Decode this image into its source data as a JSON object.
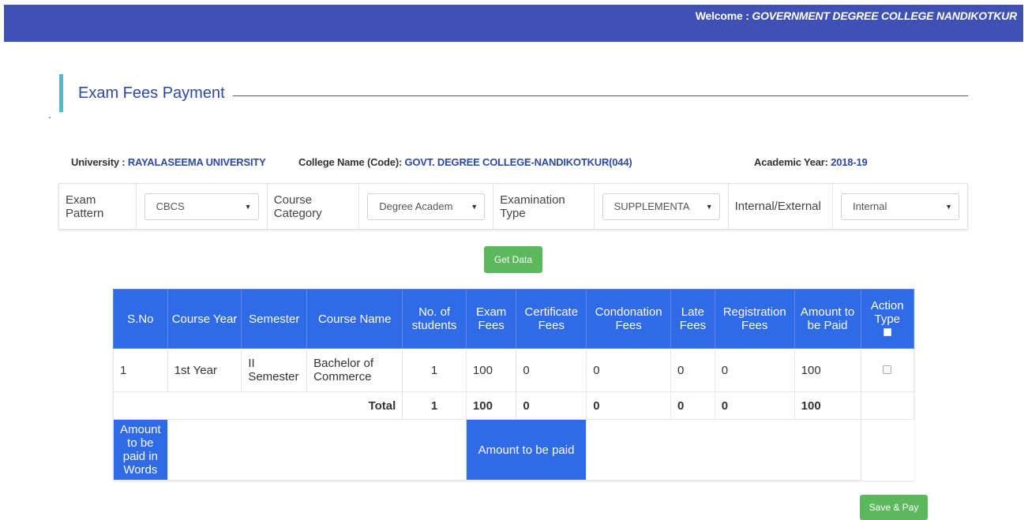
{
  "header": {
    "welcome_prefix": "Welcome : ",
    "welcome_college": "GOVERNMENT DEGREE COLLEGE NANDIKOTKUR"
  },
  "page": {
    "title": "Exam Fees Payment"
  },
  "info": {
    "university_label": "University : ",
    "university_value": "RAYALASEEMA UNIVERSITY",
    "college_label": "College Name (Code): ",
    "college_value": "GOVT. DEGREE COLLEGE-NANDIKOTKUR(044)",
    "year_label": "Academic Year: ",
    "year_value": "2018-19"
  },
  "filters": {
    "exam_pattern_label": "Exam Pattern",
    "exam_pattern_value": "CBCS",
    "course_category_label": "Course Category",
    "course_category_value": "Degree Academ",
    "exam_type_label": "Examination Type",
    "exam_type_value": "SUPPLEMENTA",
    "int_ext_label": "Internal/External",
    "int_ext_value": "Internal"
  },
  "buttons": {
    "get_data": "Get Data",
    "save_pay": "Save & Pay"
  },
  "table": {
    "headers": [
      "S.No",
      "Course Year",
      "Semester",
      "Course Name",
      "No. of students",
      "Exam Fees",
      "Certificate Fees",
      "Condonation Fees",
      "Late Fees",
      "Registration Fees",
      "Amount to be Paid",
      "Action Type"
    ],
    "row": {
      "sno": "1",
      "course_year": "1st Year",
      "semester": "II Semester",
      "course_name": "Bachelor of Commerce",
      "students": "1",
      "exam_fees": "100",
      "certificate_fees": "0",
      "condonation_fees": "0",
      "late_fees": "0",
      "registration_fees": "0",
      "amount": "100"
    },
    "total": {
      "label": "Total",
      "students": "1",
      "exam_fees": "100",
      "certificate_fees": "0",
      "condonation_fees": "0",
      "late_fees": "0",
      "registration_fees": "0",
      "amount": "100"
    },
    "words_label": "Amount to be paid in Words",
    "amount_label": "Amount to be paid"
  },
  "colors": {
    "header_bar": "#3f51b5",
    "table_header": "#2f6be6",
    "button_green": "#5cb85c",
    "accent": "#3fc3cf"
  }
}
